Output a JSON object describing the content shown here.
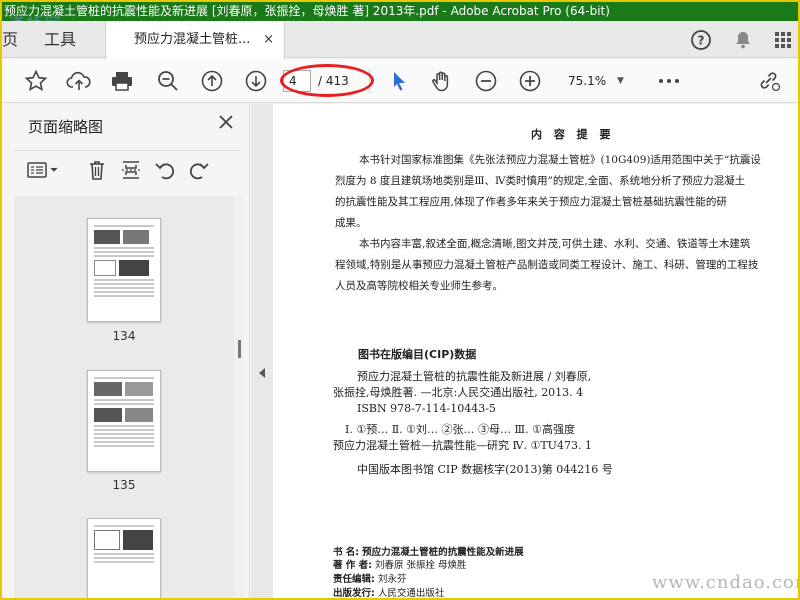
{
  "window": {
    "title": "预应力混凝土管桩的抗震性能及新进展 [刘春原，张振拴，母焕胜 著] 2013年.pdf - Adobe Acrobat Pro (64-bit)",
    "watermark_top": "道桥网",
    "watermark_bottom": "www.cndao.com"
  },
  "tabs": {
    "home_label": "页",
    "tools_label": "工具",
    "doc_label": "预应力混凝土管桩...",
    "close": "×"
  },
  "toolbar": {
    "page_current": "4",
    "page_total": "/ 413",
    "zoom": "75.1%"
  },
  "sidebar": {
    "title": "页面缩略图",
    "thumbs": [
      {
        "label": "134"
      },
      {
        "label": "135"
      }
    ]
  },
  "doc": {
    "heading": "内 容 提 要",
    "para1": [
      "本书针对国家标准图集《先张法预应力混凝土管桩》(10G409)适用范围中关于“抗震设",
      "烈度为 8 度且建筑场地类别是Ⅲ、Ⅳ类时慎用”的规定,全面、系统地分析了预应力混凝土",
      "的抗震性能及其工程应用,体现了作者多年来关于预应力混凝土管桩基础抗震性能的研",
      "成果。"
    ],
    "para2": [
      "本书内容丰富,叙述全面,概念清晰,图文并茂,可供土建、水利、交通、铁道等土木建筑",
      "程领域,特别是从事预应力混凝土管桩产品制造或同类工程设计、施工、科研、管理的工程技",
      "人员及高等院校相关专业师生参考。"
    ],
    "cip_title": "图书在版编目(CIP)数据",
    "cip_lines": [
      "预应力混凝土管桩的抗震性能及新进展 / 刘春原,",
      "张振拴,母焕胜著. —北京:人民交通出版社, 2013. 4",
      "ISBN  978-7-114-10443-5"
    ],
    "cip_lines2": [
      "Ⅰ. ①预…   Ⅱ. ①刘…  ②张…  ③母…   Ⅲ. ①高强度",
      "预应力混凝土管桩—抗震性能—研究   Ⅳ. ①TU473. 1"
    ],
    "cip_number": "中国版本图书馆 CIP 数据核字(2013)第 044216 号",
    "info": [
      {
        "k": "书        名:",
        "v": "预应力混凝土管桩的抗震性能及新进展"
      },
      {
        "k": "著  作  者:",
        "v": "刘春原    张振拴     母焕胜"
      },
      {
        "k": "责任编辑:",
        "v": "刘永芬"
      },
      {
        "k": "出版发行:",
        "v": "人民交通出版社"
      }
    ]
  }
}
